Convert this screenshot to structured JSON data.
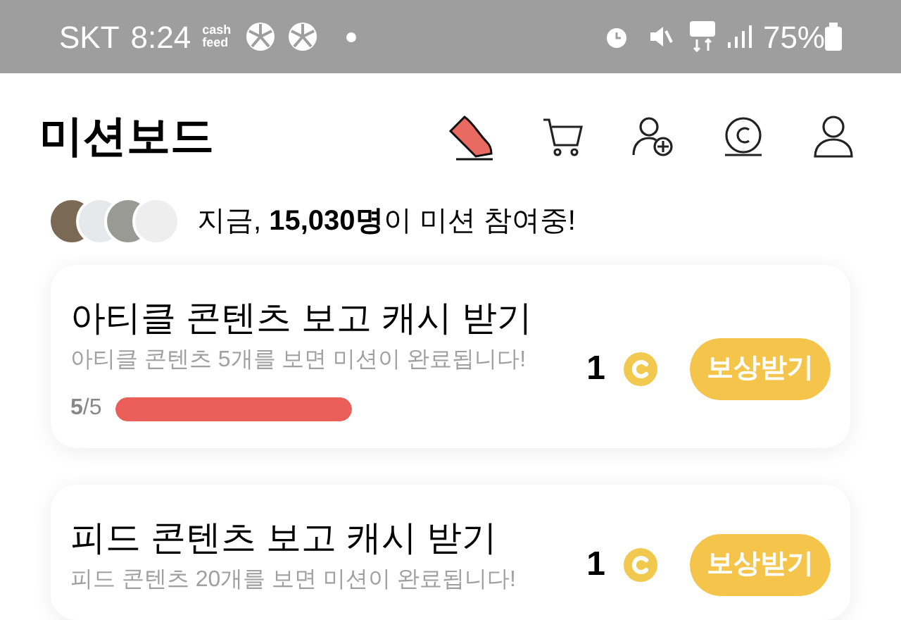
{
  "status_bar": {
    "carrier": "SKT",
    "time": "8:24",
    "app_badge": "cash feed",
    "battery": "75%"
  },
  "header": {
    "title": "미션보드"
  },
  "participation": {
    "text": "지금, **15,030명**이 미션 참여중!"
  },
  "missions": [
    {
      "title": "아티클 콘텐츠 보고 캐시 받기",
      "description": "아티클 콘텐츠 5개를 보면 미션이 완료됩니다!",
      "reward": "1",
      "button": "보상받기",
      "progress": {
        "text": "**5**/5",
        "level": 1
      }
    },
    {
      "title": "피드 콘텐츠 보고 캐시 받기",
      "description": "피드 콘텐츠 20개를 보면 미션이 완료됩니다!",
      "reward": "1",
      "button": "보상받기"
    }
  ]
}
